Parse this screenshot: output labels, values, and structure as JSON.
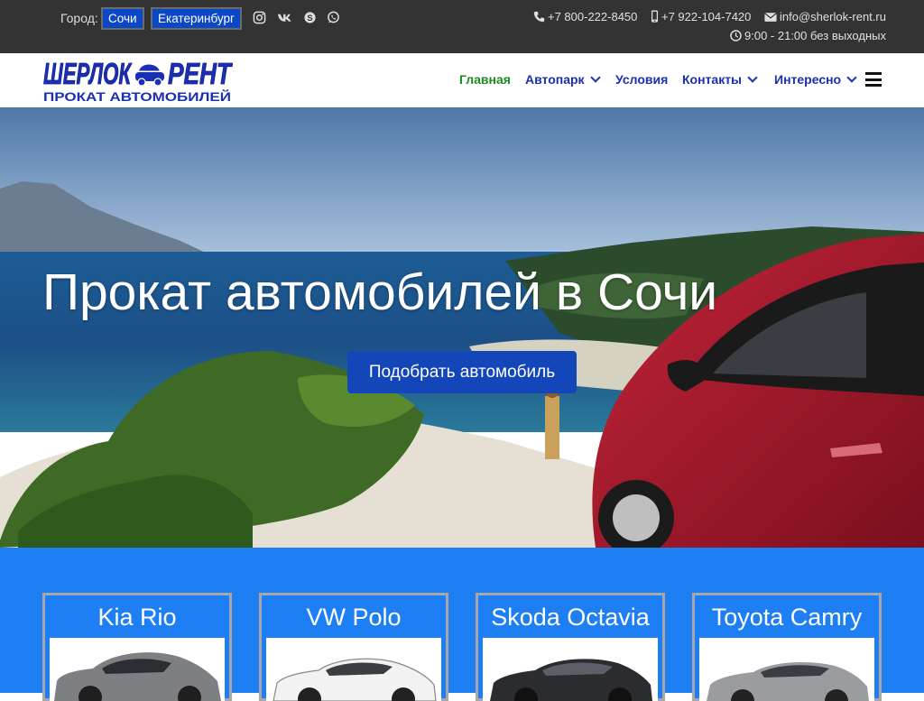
{
  "topbar": {
    "city_label": "Город:",
    "cities": [
      "Сочи",
      "Екатеринбург"
    ],
    "social_icons": [
      "instagram-icon",
      "vk-icon",
      "skype-icon",
      "whatsapp-icon"
    ],
    "phone1": "+7 800-222-8450",
    "phone2": "+7 922-104-7420",
    "email": "info@sherlok-rent.ru",
    "hours": "9:00 - 21:00 без выходных"
  },
  "logo": {
    "line1a": "ШЕРЛОК",
    "line1b": "РЕНТ",
    "line2": "ПРОКАТ АВТОМОБИЛЕЙ"
  },
  "nav": {
    "items": [
      "Главная",
      "Автопарк",
      "Условия",
      "Контакты",
      "Интересно"
    ]
  },
  "hero": {
    "title": "Прокат автомобилей в Сочи",
    "button": "Подобрать автомобиль"
  },
  "cars": [
    "Kia Rio",
    "VW Polo",
    "Skoda Octavia",
    "Toyota Camry"
  ],
  "colors": {
    "topbar": "#333333",
    "brand_blue": "#1b2fb4",
    "active_green": "#1e8a24",
    "button_blue": "#1346b8",
    "section_blue": "#1e7ff5"
  }
}
